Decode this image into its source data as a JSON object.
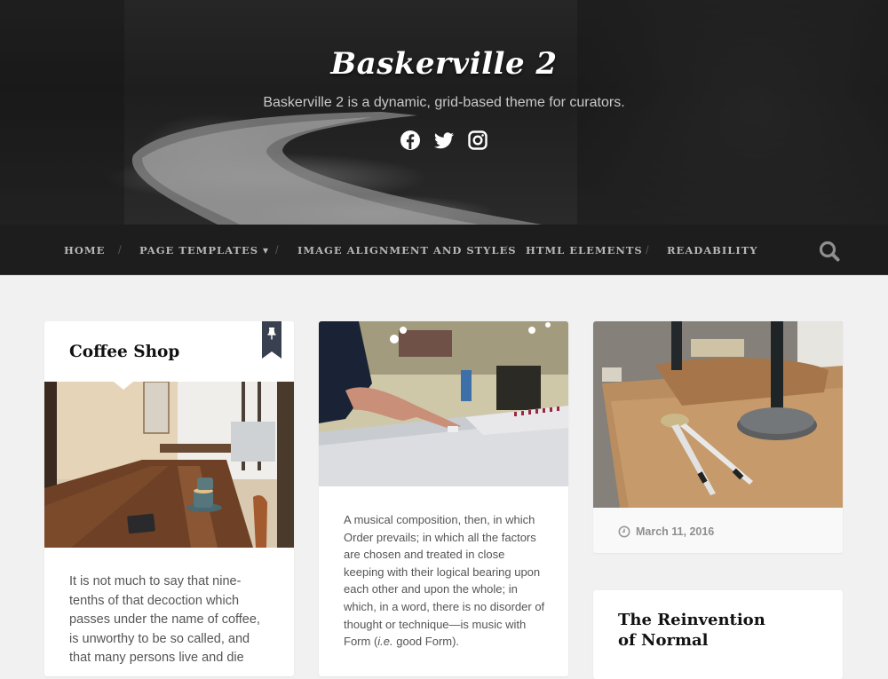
{
  "site": {
    "title": "Baskerville 2",
    "tagline": "Baskerville 2 is a dynamic, grid-based theme for curators.",
    "social": [
      "facebook-icon",
      "twitter-icon",
      "instagram-icon"
    ]
  },
  "nav": {
    "items": [
      {
        "label": "HOME"
      },
      {
        "label": "PAGE TEMPLATES",
        "has_dropdown": true
      },
      {
        "label": "IMAGE ALIGNMENT AND STYLES"
      },
      {
        "label": "HTML ELEMENTS"
      },
      {
        "label": "READABILITY"
      }
    ],
    "separator": "/",
    "dropdown_glyph": "▾",
    "search_icon": "search-icon"
  },
  "posts": [
    {
      "title": "Coffee Shop",
      "sticky": true,
      "image": "coffee-shop-table-photo",
      "excerpt_lines": [
        "It is not much to say that nine-",
        "tenths of that decoction which",
        "passes under the name of coffee,",
        "is unworthy to be so called, and",
        "that many persons live and die"
      ]
    },
    {
      "image": "mixing-console-photo",
      "excerpt_lines": [
        "A musical composition, then, in which",
        "Order prevails; in which all the factors",
        "are chosen and treated in close",
        "keeping with their logical bearing upon",
        "each other and upon the whole; in",
        "which, in a word, there is no disorder of",
        "thought or technique—is music with"
      ],
      "excerpt_last_pre": "Form (",
      "excerpt_last_em": "i.e.",
      "excerpt_last_post": " good Form)."
    },
    {
      "image": "drafting-compass-desk-photo",
      "date": "March 11, 2016"
    },
    {
      "title_lines": [
        "The Reinvention",
        "of Normal"
      ]
    }
  ],
  "colors": {
    "page_bg": "#f1f1f1",
    "nav_bg": "#1d1d1d",
    "nav_text": "#b7b7b7",
    "sticky_badge": "#394150",
    "text": "#555555",
    "title": "#111111"
  }
}
